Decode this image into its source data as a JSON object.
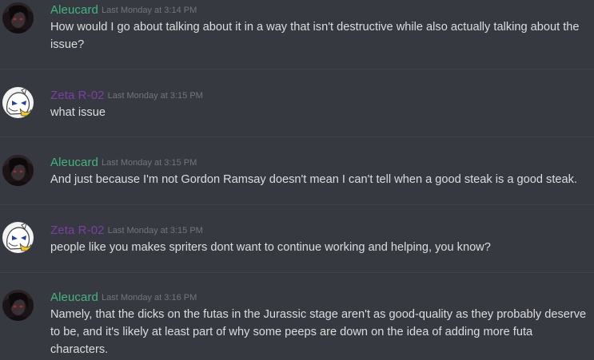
{
  "colors": {
    "background": "#36393f",
    "divider": "#41444a",
    "text": "#dcddde",
    "timestamp": "#72767d",
    "aleucard": "#43b581",
    "zeta": "#7b3fa8"
  },
  "messages": [
    {
      "author": "Aleucard",
      "avatar_icon": "dark-haired-character-avatar",
      "timestamp": "Last Monday at 3:14 PM",
      "text": "How would I go about talking about it in a way that isn't destructive while also actually talking about the issue?"
    },
    {
      "author": "Zeta R-02",
      "avatar_icon": "white-robot-character-avatar",
      "timestamp": "Last Monday at 3:15 PM",
      "text": "what issue"
    },
    {
      "author": "Aleucard",
      "avatar_icon": "dark-haired-character-avatar",
      "timestamp": "Last Monday at 3:15 PM",
      "text": "And just because I'm not Gordon Ramsay doesn't mean I can't tell when a good steak is a good steak."
    },
    {
      "author": "Zeta R-02",
      "avatar_icon": "white-robot-character-avatar",
      "timestamp": "Last Monday at 3:15 PM",
      "text": "people like you makes spriters dont want to continue working and helping, you know?"
    },
    {
      "author": "Aleucard",
      "avatar_icon": "dark-haired-character-avatar",
      "timestamp": "Last Monday at 3:16 PM",
      "text": "Namely, that the dicks on the futas in the Jurassic stage aren't as good-quality as they probably deserve to be, and it's likely at least part of why some peeps are down on the idea of adding more futa characters."
    }
  ]
}
